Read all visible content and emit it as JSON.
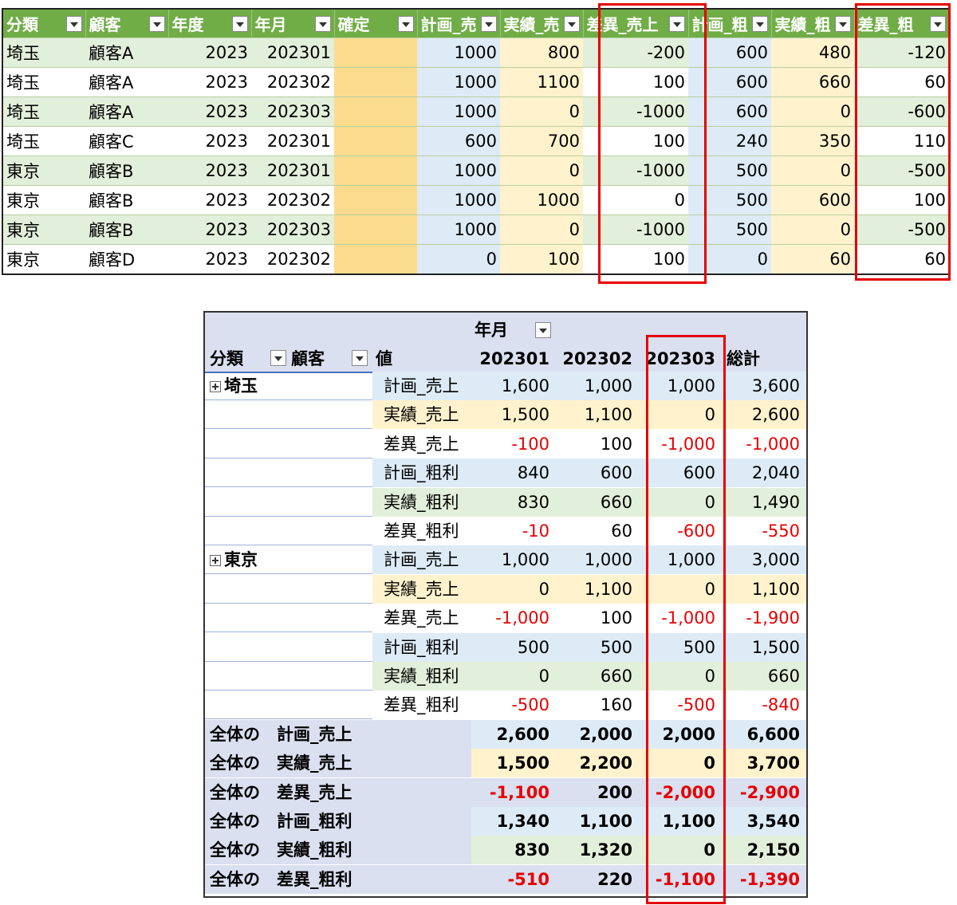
{
  "top_table": {
    "headers": [
      "分類",
      "顧客",
      "年度",
      "年月",
      "確定",
      "計画_売",
      "実績_売",
      "差異_売上",
      "計画_粗",
      "実績_粗",
      "差異_粗"
    ],
    "rows": [
      [
        "埼玉",
        "顧客A",
        "2023",
        "202301",
        "",
        "1000",
        "800",
        "-200",
        "600",
        "480",
        "-120"
      ],
      [
        "埼玉",
        "顧客A",
        "2023",
        "202302",
        "",
        "1000",
        "1100",
        "100",
        "600",
        "660",
        "60"
      ],
      [
        "埼玉",
        "顧客A",
        "2023",
        "202303",
        "",
        "1000",
        "0",
        "-1000",
        "600",
        "0",
        "-600"
      ],
      [
        "埼玉",
        "顧客C",
        "2023",
        "202301",
        "",
        "600",
        "700",
        "100",
        "240",
        "350",
        "110"
      ],
      [
        "東京",
        "顧客B",
        "2023",
        "202301",
        "",
        "1000",
        "0",
        "-1000",
        "500",
        "0",
        "-500"
      ],
      [
        "東京",
        "顧客B",
        "2023",
        "202302",
        "",
        "1000",
        "1000",
        "0",
        "500",
        "600",
        "100"
      ],
      [
        "東京",
        "顧客B",
        "2023",
        "202303",
        "",
        "1000",
        "0",
        "-1000",
        "500",
        "0",
        "-500"
      ],
      [
        "東京",
        "顧客D",
        "2023",
        "202302",
        "",
        "0",
        "100",
        "100",
        "0",
        "60",
        "60"
      ]
    ]
  },
  "pivot": {
    "col_field": "年月",
    "row_field_1": "分類",
    "row_field_2": "顧客",
    "values_label": "値",
    "columns": [
      "202301",
      "202302",
      "202303",
      "総計"
    ],
    "groups": [
      {
        "name": "埼玉",
        "rows": [
          {
            "label": "計画_売上",
            "vals": [
              "1,600",
              "1,000",
              "1,000",
              "3,600"
            ]
          },
          {
            "label": "実績_売上",
            "vals": [
              "1,500",
              "1,100",
              "0",
              "2,600"
            ]
          },
          {
            "label": "差異_売上",
            "vals": [
              "-100",
              "100",
              "-1,000",
              "-1,000"
            ]
          },
          {
            "label": "計画_粗利",
            "vals": [
              "840",
              "600",
              "600",
              "2,040"
            ]
          },
          {
            "label": "実績_粗利",
            "vals": [
              "830",
              "660",
              "0",
              "1,490"
            ]
          },
          {
            "label": "差異_粗利",
            "vals": [
              "-10",
              "60",
              "-600",
              "-550"
            ]
          }
        ]
      },
      {
        "name": "東京",
        "rows": [
          {
            "label": "計画_売上",
            "vals": [
              "1,000",
              "1,000",
              "1,000",
              "3,000"
            ]
          },
          {
            "label": "実績_売上",
            "vals": [
              "0",
              "1,100",
              "0",
              "1,100"
            ]
          },
          {
            "label": "差異_売上",
            "vals": [
              "-1,000",
              "100",
              "-1,000",
              "-1,900"
            ]
          },
          {
            "label": "計画_粗利",
            "vals": [
              "500",
              "500",
              "500",
              "1,500"
            ]
          },
          {
            "label": "実績_粗利",
            "vals": [
              "0",
              "660",
              "0",
              "660"
            ]
          },
          {
            "label": "差異_粗利",
            "vals": [
              "-500",
              "160",
              "-500",
              "-840"
            ]
          }
        ]
      }
    ],
    "totals": [
      {
        "label": "全体の　計画_売上",
        "vals": [
          "2,600",
          "2,000",
          "2,000",
          "6,600"
        ]
      },
      {
        "label": "全体の　実績_売上",
        "vals": [
          "1,500",
          "2,200",
          "0",
          "3,700"
        ]
      },
      {
        "label": "全体の　差異_売上",
        "vals": [
          "-1,100",
          "200",
          "-2,000",
          "-2,900"
        ]
      },
      {
        "label": "全体の　計画_粗利",
        "vals": [
          "1,340",
          "1,100",
          "1,100",
          "3,540"
        ]
      },
      {
        "label": "全体の　実績_粗利",
        "vals": [
          "830",
          "1,320",
          "0",
          "2,150"
        ]
      },
      {
        "label": "全体の　差異_粗利",
        "vals": [
          "-510",
          "220",
          "-1,100",
          "-1,390"
        ]
      }
    ]
  },
  "colors": {
    "header_green": "#70ad47",
    "row_green": "#e2efda",
    "plan_blue": "#ddebf7",
    "actual_yellow": "#fff2cc",
    "confirm_orange": "#fbdc8e",
    "pivot_header": "#dae0f0",
    "negative_red": "#e60000",
    "highlight_red": "#e60000"
  }
}
